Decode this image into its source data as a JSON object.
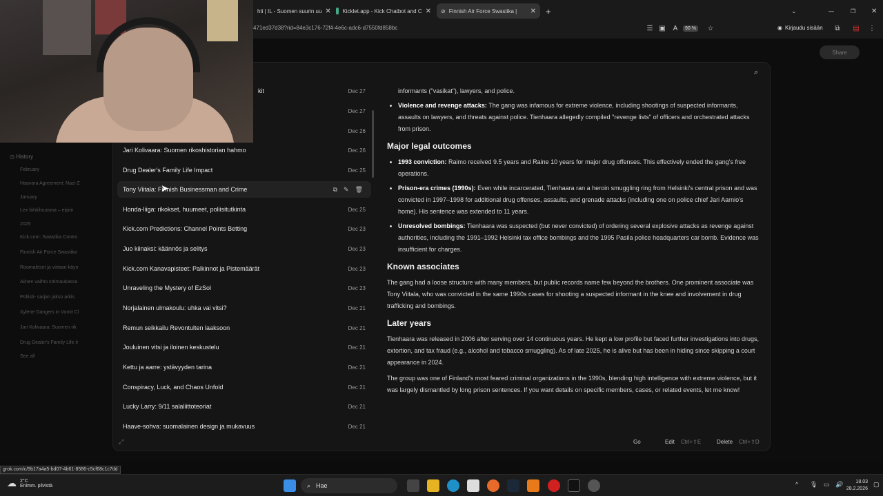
{
  "browser": {
    "tabs": [
      {
        "label": "hti | IL - Suomen suurin uu",
        "active": false
      },
      {
        "label": "Kicklet.app - Kick Chatbot and C",
        "active": false
      },
      {
        "label": "Finnish Air Force Swastika |",
        "active": true
      }
    ],
    "url": "471ed37d38?rid=84e3c176-72f4-4e6c-adc6-d7550fd858bc",
    "zoom": "90 %",
    "login": "Kirjaudu sisään",
    "share": "Share"
  },
  "left_nav": {
    "history": "History",
    "section1": "February",
    "section2": "January",
    "section3": "2025",
    "items": [
      "Haavara Agreement: Nazi-Z",
      "Lex fahtiilouoona – eipim",
      "Kick.com: Swastika Contro",
      "Finnish Air Force Swastika",
      "Roomaleset ja virtaan käyn",
      "Aiinen vaihto strimaukassa",
      "Poltisti- sarjan jakso arkis",
      "Xylene Dangers in Vomit Cl",
      "Jari Kolivaara: Suomen rik",
      "Drug Dealer's Family Life Ir"
    ],
    "see_all": "See all"
  },
  "history_list": [
    {
      "title": "kit",
      "date": "Dec 27"
    },
    {
      "title": "",
      "date": "Dec 27"
    },
    {
      "title": "",
      "date": "Dec 26"
    },
    {
      "title": "Jari Kolivaara: Suomen rikoshistorian hahmo",
      "date": "Dec 26"
    },
    {
      "title": "Drug Dealer's Family Life Impact",
      "date": "Dec 25"
    },
    {
      "title": "Tony Viitala: Finnish Businessman and Crime",
      "date": ""
    },
    {
      "title": "Honda-liiga: rikokset, huumeet, poliisitutkinta",
      "date": "Dec 25"
    },
    {
      "title": "Kick.com Predictions: Channel Points Betting",
      "date": "Dec 23"
    },
    {
      "title": "Juo kiinaksi: käännös ja selitys",
      "date": "Dec 23"
    },
    {
      "title": "Kick.com Kanavapisteet: Palkinnot ja Pistemäärät",
      "date": "Dec 23"
    },
    {
      "title": "Unraveling the Mystery of EzSol",
      "date": "Dec 23"
    },
    {
      "title": "Norjalainen ulmakoulu: uhka vai vitsi?",
      "date": "Dec 21"
    },
    {
      "title": "Remun seikkailu Revontulten laaksoon",
      "date": "Dec 21"
    },
    {
      "title": "Jouluinen vitsi ja iloinen keskustelu",
      "date": "Dec 21"
    },
    {
      "title": "Kettu ja aarre: ystävyyden tarina",
      "date": "Dec 21"
    },
    {
      "title": "Conspiracy, Luck, and Chaos Unfold",
      "date": "Dec 21"
    },
    {
      "title": "Lucky Larry: 9/11 salaliittoteoriat",
      "date": "Dec 21"
    },
    {
      "title": "Haave-sohva: suomalainen design ja mukavuus",
      "date": "Dec 21"
    }
  ],
  "content": {
    "bullet0": "informants (\"vasikat\"), lawyers, and police.",
    "b1_label": "Violence and revenge attacks:",
    "b1_text": " The gang was infamous for extreme violence, including shootings of suspected informants, assaults on lawyers, and threats against police. Tienhaara allegedly compiled \"revenge lists\" of officers and orchestrated attacks from prison.",
    "h1": "Major legal outcomes",
    "b2_label": "1993 conviction:",
    "b2_text": " Raimo received 9.5 years and Raine 10 years for major drug offenses. This effectively ended the gang's free operations.",
    "b3_label": "Prison-era crimes (1990s):",
    "b3_text": " Even while incarcerated, Tienhaara ran a heroin smuggling ring from Helsinki's central prison and was convicted in 1997–1998 for additional drug offenses, assaults, and grenade attacks (including one on police chief Jari Aarnio's home). His sentence was extended to 11 years.",
    "b4_label": "Unresolved bombings:",
    "b4_text": " Tienhaara was suspected (but never convicted) of ordering several explosive attacks as revenge against authorities, including the 1991–1992 Helsinki tax office bombings and the 1995 Pasila police headquarters car bomb. Evidence was insufficient for charges.",
    "h2": "Known associates",
    "p1": "The gang had a loose structure with many members, but public records name few beyond the brothers. One prominent associate was Tony Viitala, who was convicted in the same 1990s cases for shooting a suspected informant in the knee and involvement in drug trafficking and bombings.",
    "h3": "Later years",
    "p2": "Tienhaara was released in 2006 after serving over 14 continuous years. He kept a low profile but faced further investigations into drugs, extortion, and tax fraud (e.g., alcohol and tobacco smuggling). As of late 2025, he is alive but has been in hiding since skipping a court appearance in 2024.",
    "p3": "The group was one of Finland's most feared criminal organizations in the 1990s, blending high intelligence with extreme violence, but it was largely dismantled by long prison sentences. If you want details on specific members, cases, or related events, let me know!"
  },
  "footer": {
    "go": "Go",
    "edit": "Edit",
    "edit_kbd": "Ctrl+⇧E",
    "delete": "Delete",
    "delete_kbd": "Ctrl+⇧D"
  },
  "status_url": "grok.com/c/9b17a4a5-bd07-4b61-8586-c5cf68c1c7dd",
  "taskbar": {
    "temp": "2°C",
    "weather": "Enimm. pilvistä",
    "search": "Hae",
    "time": "18.03",
    "date": "28.2.2026"
  }
}
